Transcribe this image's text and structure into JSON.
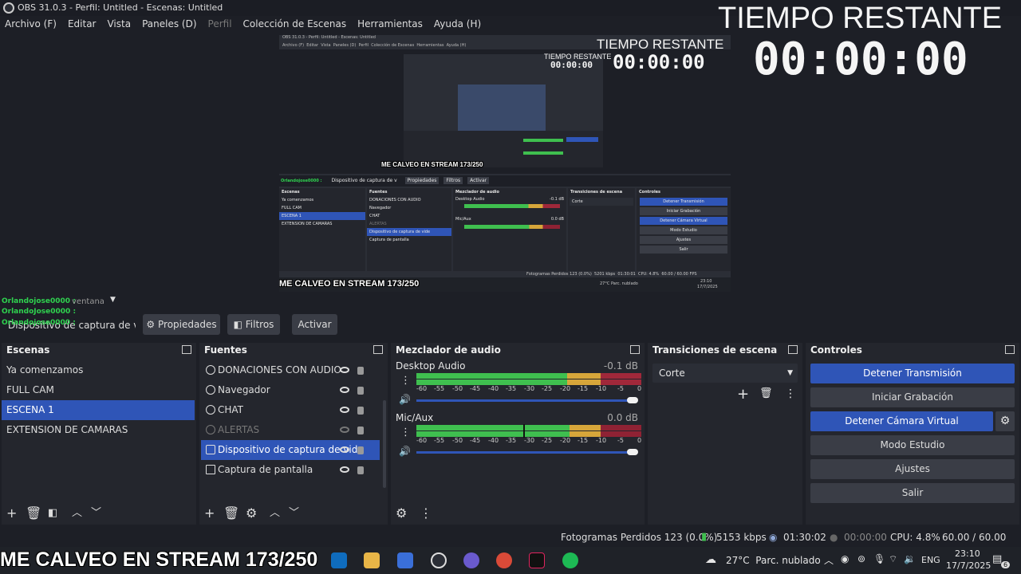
{
  "window": {
    "title": "OBS 31.0.3 - Perfil: Untitled - Escenas: Untitled"
  },
  "menu": {
    "items": [
      "Archivo (F)",
      "Editar",
      "Vista",
      "Paneles (D)",
      "Perfil",
      "Colección de Escenas",
      "Herramientas",
      "Ayuda (H)"
    ]
  },
  "overlay": {
    "countdown_label": "TIEMPO RESTANTE",
    "countdown_value": "00:00:00",
    "stream_title": "ME CALVEO EN STREAM 173/250",
    "chat_user": "Orlandojose0000 :",
    "chat_user_alt": "OrlandoJose0000 :"
  },
  "nested": {
    "menu": [
      "Archivo (F)",
      "Editar",
      "Vista",
      "Paneles (D)",
      "Perfil",
      "Colección de Escenas",
      "Herramientas",
      "Ayuda (H)"
    ],
    "scenes_title": "Escenas",
    "sources_title": "Fuentes",
    "mixer_title": "Mezclador de audio",
    "transitions_title": "Transiciones de escena",
    "controls_title": "Controles",
    "scenes": [
      "Ya comenzamos",
      "FULL CAM",
      "ESCENA 1",
      "EXTENSION DE CAMARAS"
    ],
    "sources": [
      "DONACIONES CON AUDIO",
      "Navegador",
      "CHAT",
      "ALERTAS",
      "Dispositivo de captura de vide",
      "Captura de pantalla"
    ],
    "controls": [
      "Detener Transmisión",
      "Iniciar Grabación",
      "Detener Cámara Virtual",
      "Modo Estudio",
      "Ajustes",
      "Salir"
    ],
    "status": "Fotogramas Perdidos 123 (0.0%)",
    "kbps": "5201 kbps",
    "time": "01:30:01",
    "cpu": "CPU: 4.8%",
    "fps": "60.00 / 60.00 FPS",
    "weather": "27°C Parc. nublado",
    "clock_time": "23:10",
    "clock_date": "17/7/2025",
    "source_tab": "Dispositivo de captura de v",
    "props": "Propiedades",
    "filters": "Filtros",
    "activate": "Activar",
    "transition": "Corte",
    "desktop_audio": "Desktop Audio",
    "desktop_db": "-0.1 dB",
    "mic": "Mic/Aux",
    "mic_db": "0.0 dB"
  },
  "source_toolbar": {
    "source_name": "Dispositivo de captura de v",
    "window_dropdown": "ventana",
    "properties": "Propiedades",
    "filters": "Filtros",
    "activate": "Activar"
  },
  "scenes": {
    "title": "Escenas",
    "items": [
      "Ya comenzamos",
      "FULL CAM",
      "ESCENA 1",
      "EXTENSION DE CAMARAS"
    ],
    "selected": "ESCENA 1"
  },
  "sources": {
    "title": "Fuentes",
    "items": [
      "DONACIONES CON AUDIO",
      "Navegador",
      "CHAT",
      "ALERTAS",
      "Dispositivo de captura de vide",
      "Captura de pantalla"
    ],
    "selected": "Dispositivo de captura de vide"
  },
  "mixer": {
    "title": "Mezclador de audio",
    "channels": [
      {
        "name": "Desktop Audio",
        "db": "-0.1 dB"
      },
      {
        "name": "Mic/Aux",
        "db": "0.0 dB"
      }
    ],
    "ticks": [
      "-60",
      "-55",
      "-50",
      "-45",
      "-40",
      "-35",
      "-30",
      "-25",
      "-20",
      "-15",
      "-10",
      "-5",
      "0"
    ]
  },
  "transitions": {
    "title": "Transiciones de escena",
    "selected": "Corte"
  },
  "controls": {
    "title": "Controles",
    "buttons": [
      "Detener Transmisión",
      "Iniciar Grabación",
      "Detener Cámara Virtual",
      "Modo Estudio",
      "Ajustes",
      "Salir"
    ]
  },
  "status": {
    "dropped": "Fotogramas Perdidos 123 (0.0%)",
    "kbps": "5153 kbps",
    "stream_time": "01:30:02",
    "rec_time": "00:00:00",
    "cpu": "CPU: 4.8%",
    "fps": "60.00 / 60.00 FPS"
  },
  "taskbar": {
    "weather": "27°C  Parc. nublado",
    "lang": "ENG",
    "time": "23:10",
    "date": "17/7/2025",
    "notif_count": "6"
  },
  "colors": {
    "accent": "#2f55b7",
    "bg": "#1d1f26",
    "panel": "#24262d",
    "meter_green": "#3fbf4f",
    "meter_yellow": "#d7a63a",
    "meter_red": "#a0283a"
  }
}
